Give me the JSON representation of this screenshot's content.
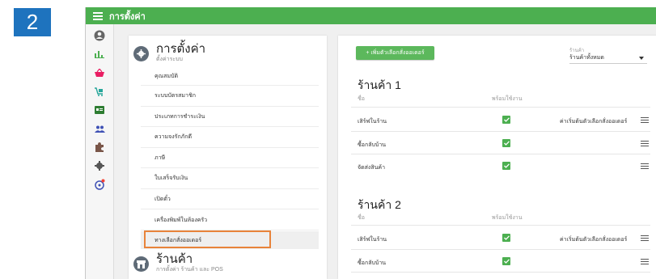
{
  "step_number": "2",
  "colors": {
    "topbar": "#4caf50",
    "highlight": "#e8833a",
    "button": "#5cb85c",
    "badge": "#1e73be"
  },
  "topbar": {
    "title": "การตั้งค่า"
  },
  "sidebar": {
    "icons": [
      "account-icon",
      "chart-icon",
      "basket-icon",
      "delivery-icon",
      "id-card-icon",
      "users-icon",
      "puzzle-icon",
      "gear-icon",
      "help-icon"
    ]
  },
  "menu": {
    "section1": {
      "title": "การตั้งค่า",
      "subtitle": "ตั้งค่าระบบ"
    },
    "items": [
      "คุณสมบัติ",
      "ระบบบัตรสมาชิก",
      "ประเภทการชำระเงิน",
      "ความจงรักภักดี",
      "ภาษี",
      "ใบเสร็จรับเงิน",
      "เปิดตั๋ว",
      "เครื่องพิมพ์ในห้องครัว",
      "ทางเลือกสั่งออเดอร์"
    ],
    "highlighted_item": "ทางเลือกสั่งออเดอร์",
    "section2": {
      "title": "ร้านค้า",
      "subtitle": "การตั้งค่า ร้านค้า และ POS"
    }
  },
  "content": {
    "add_button": "+ เพิ่มตัวเลือกสั่งออเดอร์",
    "store_filter": {
      "label": "ร้านค้า",
      "value": "ร้านค้าทั้งหมด"
    },
    "stores": [
      {
        "title": "ร้านค้า 1",
        "col_name": "ชื่อ",
        "col_available": "พร้อมใช้งาน",
        "rows": [
          {
            "name": "เสิร์ฟในร้าน",
            "available": true,
            "note": "ค่าเริ่มต้นตัวเลือกสั่งออเดอร์"
          },
          {
            "name": "ซื้อกลับบ้าน",
            "available": true,
            "note": ""
          },
          {
            "name": "จัดส่งสินค้า",
            "available": true,
            "note": ""
          }
        ]
      },
      {
        "title": "ร้านค้า 2",
        "col_name": "ชื่อ",
        "col_available": "พร้อมใช้งาน",
        "rows": [
          {
            "name": "เสิร์ฟในร้าน",
            "available": true,
            "note": "ค่าเริ่มต้นตัวเลือกสั่งออเดอร์"
          },
          {
            "name": "ซื้อกลับบ้าน",
            "available": true,
            "note": ""
          }
        ]
      }
    ]
  }
}
